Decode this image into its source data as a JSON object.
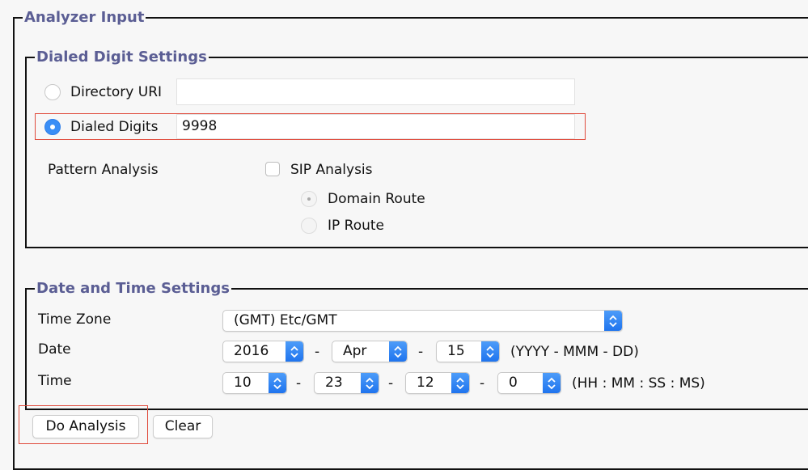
{
  "analyzer_input": {
    "legend": "Analyzer Input"
  },
  "dialed_digit_settings": {
    "legend": "Dialed Digit Settings",
    "directory_uri": {
      "label": "Directory URI",
      "value": "",
      "selected": false
    },
    "dialed_digits": {
      "label": "Dialed Digits",
      "value": "9998",
      "selected": true
    },
    "pattern_analysis_label": "Pattern Analysis",
    "sip_analysis": {
      "label": "SIP Analysis",
      "checked": false
    },
    "domain_route": {
      "label": "Domain Route",
      "selected": true,
      "disabled": true
    },
    "ip_route": {
      "label": "IP Route",
      "selected": false,
      "disabled": true
    }
  },
  "date_time_settings": {
    "legend": "Date and Time Settings",
    "time_zone": {
      "label": "Time Zone",
      "value": "(GMT) Etc/GMT"
    },
    "date": {
      "label": "Date",
      "year": "2016",
      "month": "Apr",
      "day": "15",
      "separator": "-",
      "format_hint": "(YYYY - MMM - DD)"
    },
    "time": {
      "label": "Time",
      "hour": "10",
      "minute": "23",
      "second": "12",
      "millisecond": "0",
      "separator": "-",
      "format_hint": "(HH : MM : SS : MS)"
    }
  },
  "buttons": {
    "do_analysis": "Do Analysis",
    "clear": "Clear"
  },
  "colors": {
    "legend_text": "#5b5e94",
    "highlight_box": "#e04b3c",
    "select_accent": "#2f7fe8"
  }
}
